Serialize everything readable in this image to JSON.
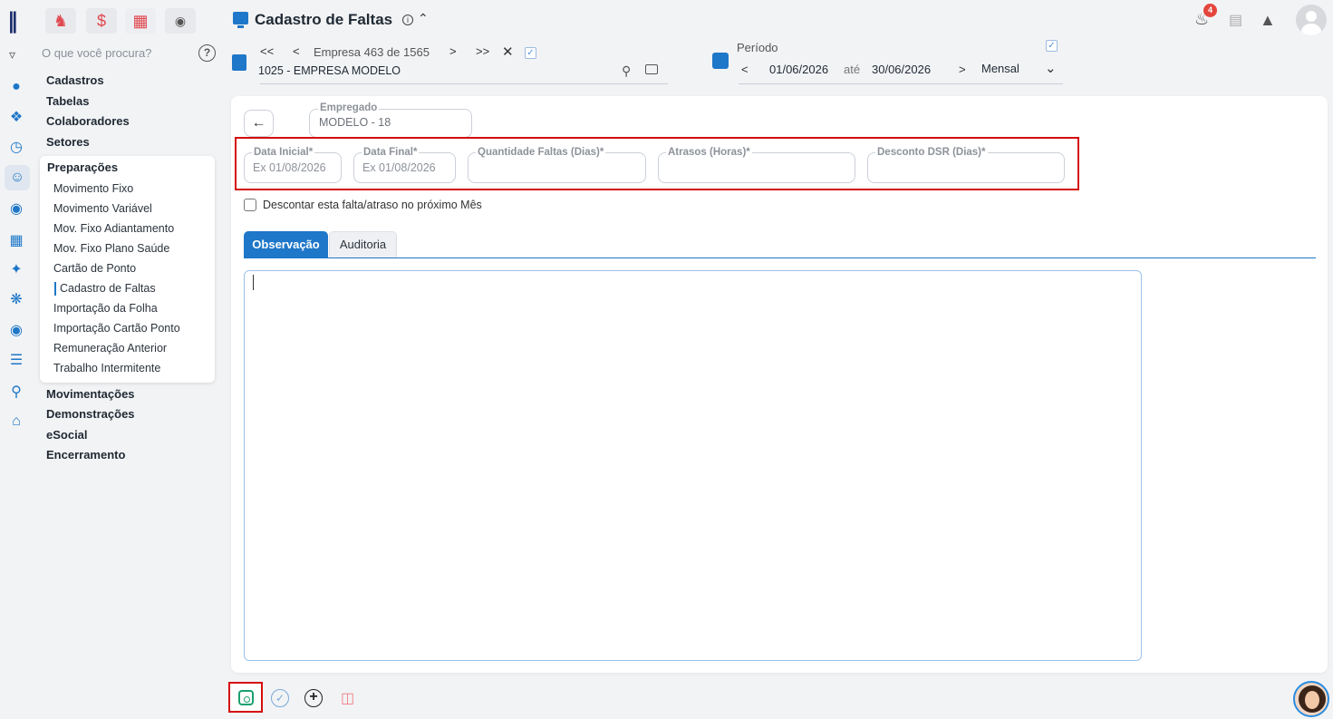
{
  "modules": [
    {
      "name": "people-icon",
      "glyph": "&#9822;"
    },
    {
      "name": "dollar-icon",
      "glyph": "$"
    },
    {
      "name": "table-icon",
      "glyph": "&#9638;"
    },
    {
      "name": "money-bag-icon",
      "glyph": "&#9673;"
    }
  ],
  "search": {
    "placeholder": "O que você procura?"
  },
  "nav": {
    "top_items": [
      "Cadastros",
      "Tabelas",
      "Colaboradores",
      "Setores"
    ],
    "open_section": "Preparações",
    "sub_items": [
      "Movimento Fixo",
      "Movimento Variável",
      "Mov. Fixo Adiantamento",
      "Mov. Fixo Plano Saúde",
      "Cartão de Ponto",
      "Cadastro de Faltas",
      "Importação da Folha",
      "Importação Cartão Ponto",
      "Remuneração Anterior",
      "Trabalho Intermitente"
    ],
    "bottom_items": [
      "Movimentações",
      "Demonstrações",
      "eSocial",
      "Encerramento"
    ]
  },
  "header": {
    "title": "Cadastro de Faltas",
    "company_counter": "Empresa 463 de 1565",
    "company_name": "1025 - EMPRESA MODELO",
    "period_label": "Período",
    "date_start": "01/06/2026",
    "date_sep": "até",
    "date_end": "30/06/2026",
    "period_type": "Mensal",
    "notifications": "4"
  },
  "form": {
    "employee_label": "Empregado",
    "employee_value": "MODELO - 18",
    "fields": [
      {
        "label": "Data Inicial*",
        "placeholder": "Ex 01/08/2026"
      },
      {
        "label": "Data Final*",
        "placeholder": "Ex 01/08/2026"
      },
      {
        "label": "Quantidade Faltas (Dias)*",
        "placeholder": ""
      },
      {
        "label": "Atrasos (Horas)*",
        "placeholder": ""
      },
      {
        "label": "Desconto DSR (Dias)*",
        "placeholder": ""
      }
    ],
    "checkbox_label": "Descontar esta falta/atraso no próximo Mês",
    "tabs": [
      "Observação",
      "Auditoria"
    ]
  },
  "colors": {
    "accent": "#1e77c8",
    "highlight": "#d50c0c",
    "save": "#1aa06e",
    "danger": "#f07d84"
  }
}
